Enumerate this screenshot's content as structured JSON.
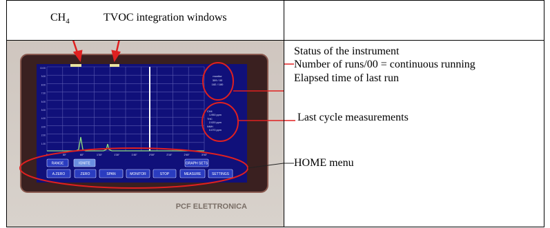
{
  "header": {
    "ch4_label": "CH",
    "ch4_sub": "4",
    "tvoc_label": "TVOC integration windows"
  },
  "annotations": {
    "status": "Status of the instrument",
    "runs": "Number of runs/00 = continuous running",
    "elapsed": "Elapsed time of last run",
    "last_cycle": "Last cycle measurements",
    "home_menu": "HOME menu"
  },
  "device": {
    "brand": "PCF ELETTRONICA",
    "status_lines": [
      "monitor",
      "309 / 00",
      "182 / 180"
    ],
    "readings": [
      {
        "name": "CH4",
        "value": "1.950  ppm"
      },
      {
        "name": "THC",
        "value": "2.020  ppm"
      },
      {
        "name": "NMH",
        "value": "0.070  ppm"
      }
    ],
    "x_ticks": [
      "0",
      "30\"",
      "60\"",
      "1'30\"",
      "1'30\"",
      "1'45\"",
      "2'00\"",
      "2'15\"",
      "2'45\"",
      "3'00\""
    ],
    "y_ticks": [
      "10.00",
      "9.00",
      "8.00",
      "7.00",
      "6.00",
      "5.00",
      "4.00",
      "3.00",
      "2.00",
      "1.00"
    ],
    "menu_row1": [
      "RANGE",
      "IGNITE",
      "GRAPH SETS"
    ],
    "menu_row2": [
      "A.ZERO",
      "ZERO",
      "SPAN",
      "MONITOR",
      "STOP",
      "MEASURE",
      "SETTINGS"
    ]
  },
  "colors": {
    "highlight": "#e02020",
    "screen": "#10107a",
    "panel": "#3a2020"
  }
}
